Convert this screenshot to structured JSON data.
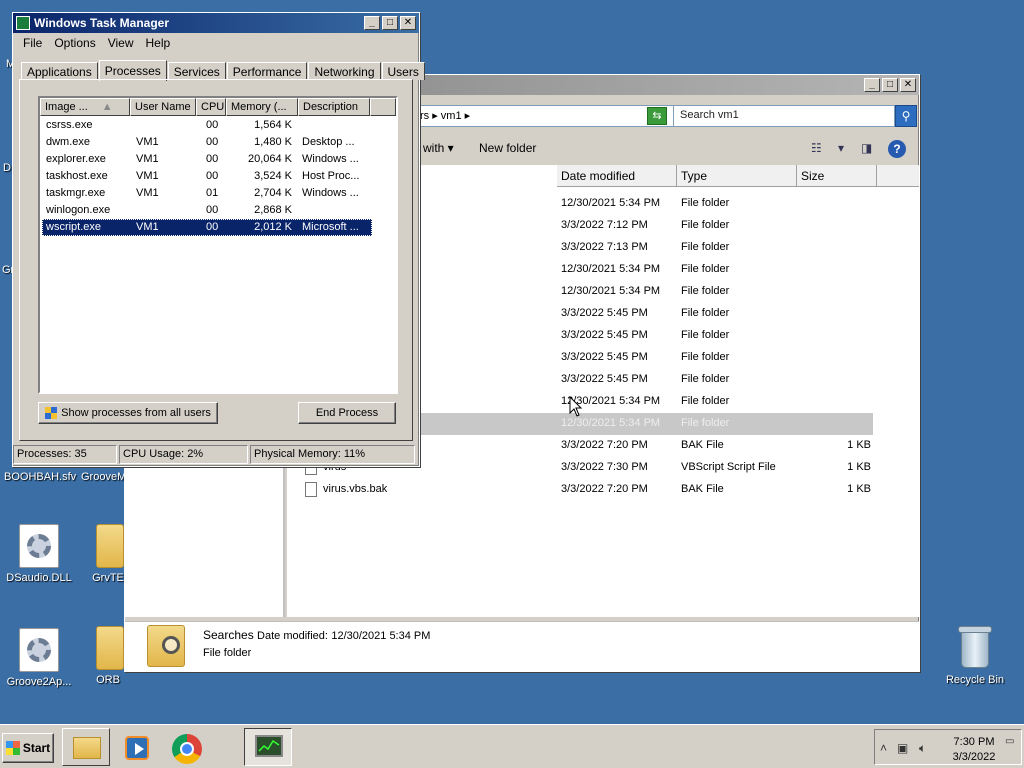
{
  "desktop": {
    "left_letters": [
      "M",
      "D",
      "Gr"
    ],
    "icons": [
      {
        "label": "BOOHBAH.sfv"
      },
      {
        "label": "GrooveM"
      },
      {
        "label": "DSaudio.DLL"
      },
      {
        "label": "GrvTE"
      },
      {
        "label": "Groove2Ap..."
      },
      {
        "label": "ORB"
      },
      {
        "label": "Recycle Bin"
      }
    ]
  },
  "explorer": {
    "address": "rs ▸ vm1 ▸",
    "search_placeholder": "Search vm1",
    "cmd_open_with": "with",
    "cmd_new_folder": "New folder",
    "columns": {
      "date": "Date modified",
      "type": "Type",
      "size": "Size"
    },
    "rows": [
      {
        "name": "",
        "date": "12/30/2021 5:34 PM",
        "type": "File folder",
        "size": ""
      },
      {
        "name": "",
        "date": "3/3/2022 7:12 PM",
        "type": "File folder",
        "size": ""
      },
      {
        "name": "",
        "date": "3/3/2022 7:13 PM",
        "type": "File folder",
        "size": ""
      },
      {
        "name": "",
        "date": "12/30/2021 5:34 PM",
        "type": "File folder",
        "size": ""
      },
      {
        "name": "",
        "date": "12/30/2021 5:34 PM",
        "type": "File folder",
        "size": ""
      },
      {
        "name": "",
        "date": "3/3/2022 5:45 PM",
        "type": "File folder",
        "size": ""
      },
      {
        "name": "",
        "date": "3/3/2022 5:45 PM",
        "type": "File folder",
        "size": ""
      },
      {
        "name": "",
        "date": "3/3/2022 5:45 PM",
        "type": "File folder",
        "size": ""
      },
      {
        "name": "",
        "date": "3/3/2022 5:45 PM",
        "type": "File folder",
        "size": ""
      },
      {
        "name": "",
        "date": "12/30/2021 5:34 PM",
        "type": "File folder",
        "size": ""
      },
      {
        "name": "",
        "date": "12/30/2021 5:34 PM",
        "type": "File folder",
        "size": ""
      },
      {
        "name": "",
        "date": "3/3/2022 7:20 PM",
        "type": "BAK File",
        "size": "1 KB"
      },
      {
        "name": "virus",
        "date": "3/3/2022 7:30 PM",
        "type": "VBScript Script File",
        "size": "1 KB"
      },
      {
        "name": "virus.vbs.bak",
        "date": "3/3/2022 7:20 PM",
        "type": "BAK File",
        "size": "1 KB"
      }
    ],
    "details": {
      "name": "Searches",
      "date_label": "Date modified:",
      "date_value": "12/30/2021 5:34 PM",
      "type": "File folder"
    }
  },
  "taskmgr": {
    "title": "Windows Task Manager",
    "menu": [
      "File",
      "Options",
      "View",
      "Help"
    ],
    "tabs": [
      "Applications",
      "Processes",
      "Services",
      "Performance",
      "Networking",
      "Users"
    ],
    "active_tab": "Processes",
    "columns": [
      "Image ...",
      "User Name",
      "CPU",
      "Memory (...",
      "Description"
    ],
    "processes": [
      {
        "image": "csrss.exe",
        "user": "",
        "cpu": "00",
        "memory": "1,564 K",
        "description": ""
      },
      {
        "image": "dwm.exe",
        "user": "VM1",
        "cpu": "00",
        "memory": "1,480 K",
        "description": "Desktop ..."
      },
      {
        "image": "explorer.exe",
        "user": "VM1",
        "cpu": "00",
        "memory": "20,064 K",
        "description": "Windows ..."
      },
      {
        "image": "taskhost.exe",
        "user": "VM1",
        "cpu": "00",
        "memory": "3,524 K",
        "description": "Host Proc..."
      },
      {
        "image": "taskmgr.exe",
        "user": "VM1",
        "cpu": "01",
        "memory": "2,704 K",
        "description": "Windows ..."
      },
      {
        "image": "winlogon.exe",
        "user": "",
        "cpu": "00",
        "memory": "2,868 K",
        "description": ""
      },
      {
        "image": "wscript.exe",
        "user": "VM1",
        "cpu": "00",
        "memory": "2,012 K",
        "description": "Microsoft ..."
      }
    ],
    "selected_process": "wscript.exe",
    "show_all_label": "Show processes from all users",
    "end_process_label": "End Process",
    "status": {
      "processes": "Processes: 35",
      "cpu": "CPU Usage: 2%",
      "memory": "Physical Memory: 11%"
    }
  },
  "taskbar": {
    "start_label": "Start",
    "apps": [
      "file-explorer-icon",
      "media-player-icon",
      "chrome-icon",
      "task-manager-icon"
    ],
    "clock_time": "7:30 PM",
    "clock_date": "3/3/2022"
  }
}
